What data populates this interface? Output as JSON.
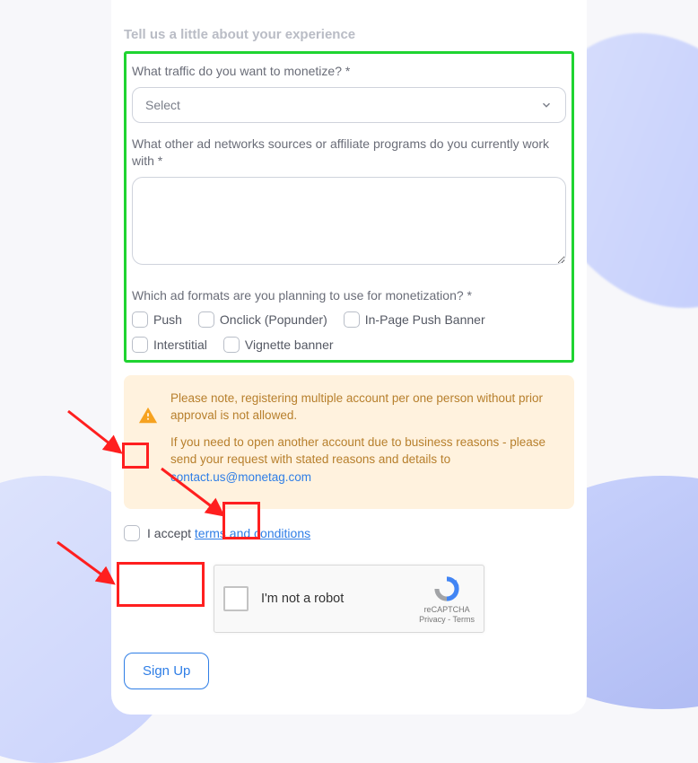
{
  "section_title": "Tell us a little about your experience",
  "traffic": {
    "label": "What traffic do you want to monetize? *",
    "placeholder": "Select"
  },
  "networks": {
    "label": "What other ad networks sources or affiliate programs do you currently work with *"
  },
  "formats": {
    "label": "Which ad formats are you planning to use for monetization? *",
    "options": [
      "Push",
      "Onclick (Popunder)",
      "In-Page Push Banner",
      "Interstitial",
      "Vignette banner"
    ]
  },
  "notice": {
    "line1": "Please note, registering multiple account per one person without prior approval is not allowed.",
    "line2": "If you need to open another account due to business reasons - please send your request with stated reasons and details to ",
    "email": "contact.us@monetag.com"
  },
  "terms": {
    "prefix": "I accept ",
    "link": "terms and conditions"
  },
  "recaptcha": {
    "label": "I'm not a robot",
    "brand": "reCAPTCHA",
    "legal": "Privacy - Terms"
  },
  "signup": "Sign Up"
}
